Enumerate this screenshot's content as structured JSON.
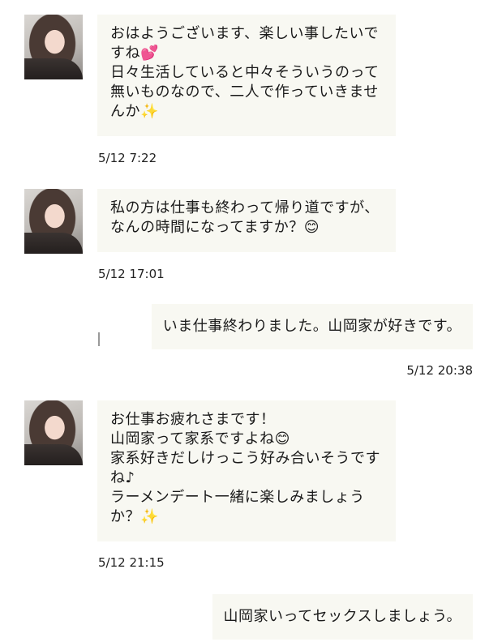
{
  "messages": [
    {
      "from": "partner",
      "text": "おはようございます、楽しい事したいですね💕\n日々生活していると中々そういうのって無いものなので、二人で作っていきませんか✨",
      "time": "5/12 7:22"
    },
    {
      "from": "partner",
      "text": "私の方は仕事も終わって帰り道ですが、なんの時間になってますか？😊",
      "time": "5/12 17:01"
    },
    {
      "from": "me",
      "text": "いま仕事終わりました。山岡家が好きです。",
      "time": "5/12 20:38"
    },
    {
      "from": "partner",
      "text": "お仕事お疲れさまです！\n山岡家って家系ですよね😊\n家系好きだしけっこう好み合いそうですね♪\nラーメンデート一緒に楽しみましょうか？✨",
      "time": "5/12 21:15"
    },
    {
      "from": "me",
      "text": "山岡家いってセックスしましょう。",
      "time": ""
    }
  ]
}
